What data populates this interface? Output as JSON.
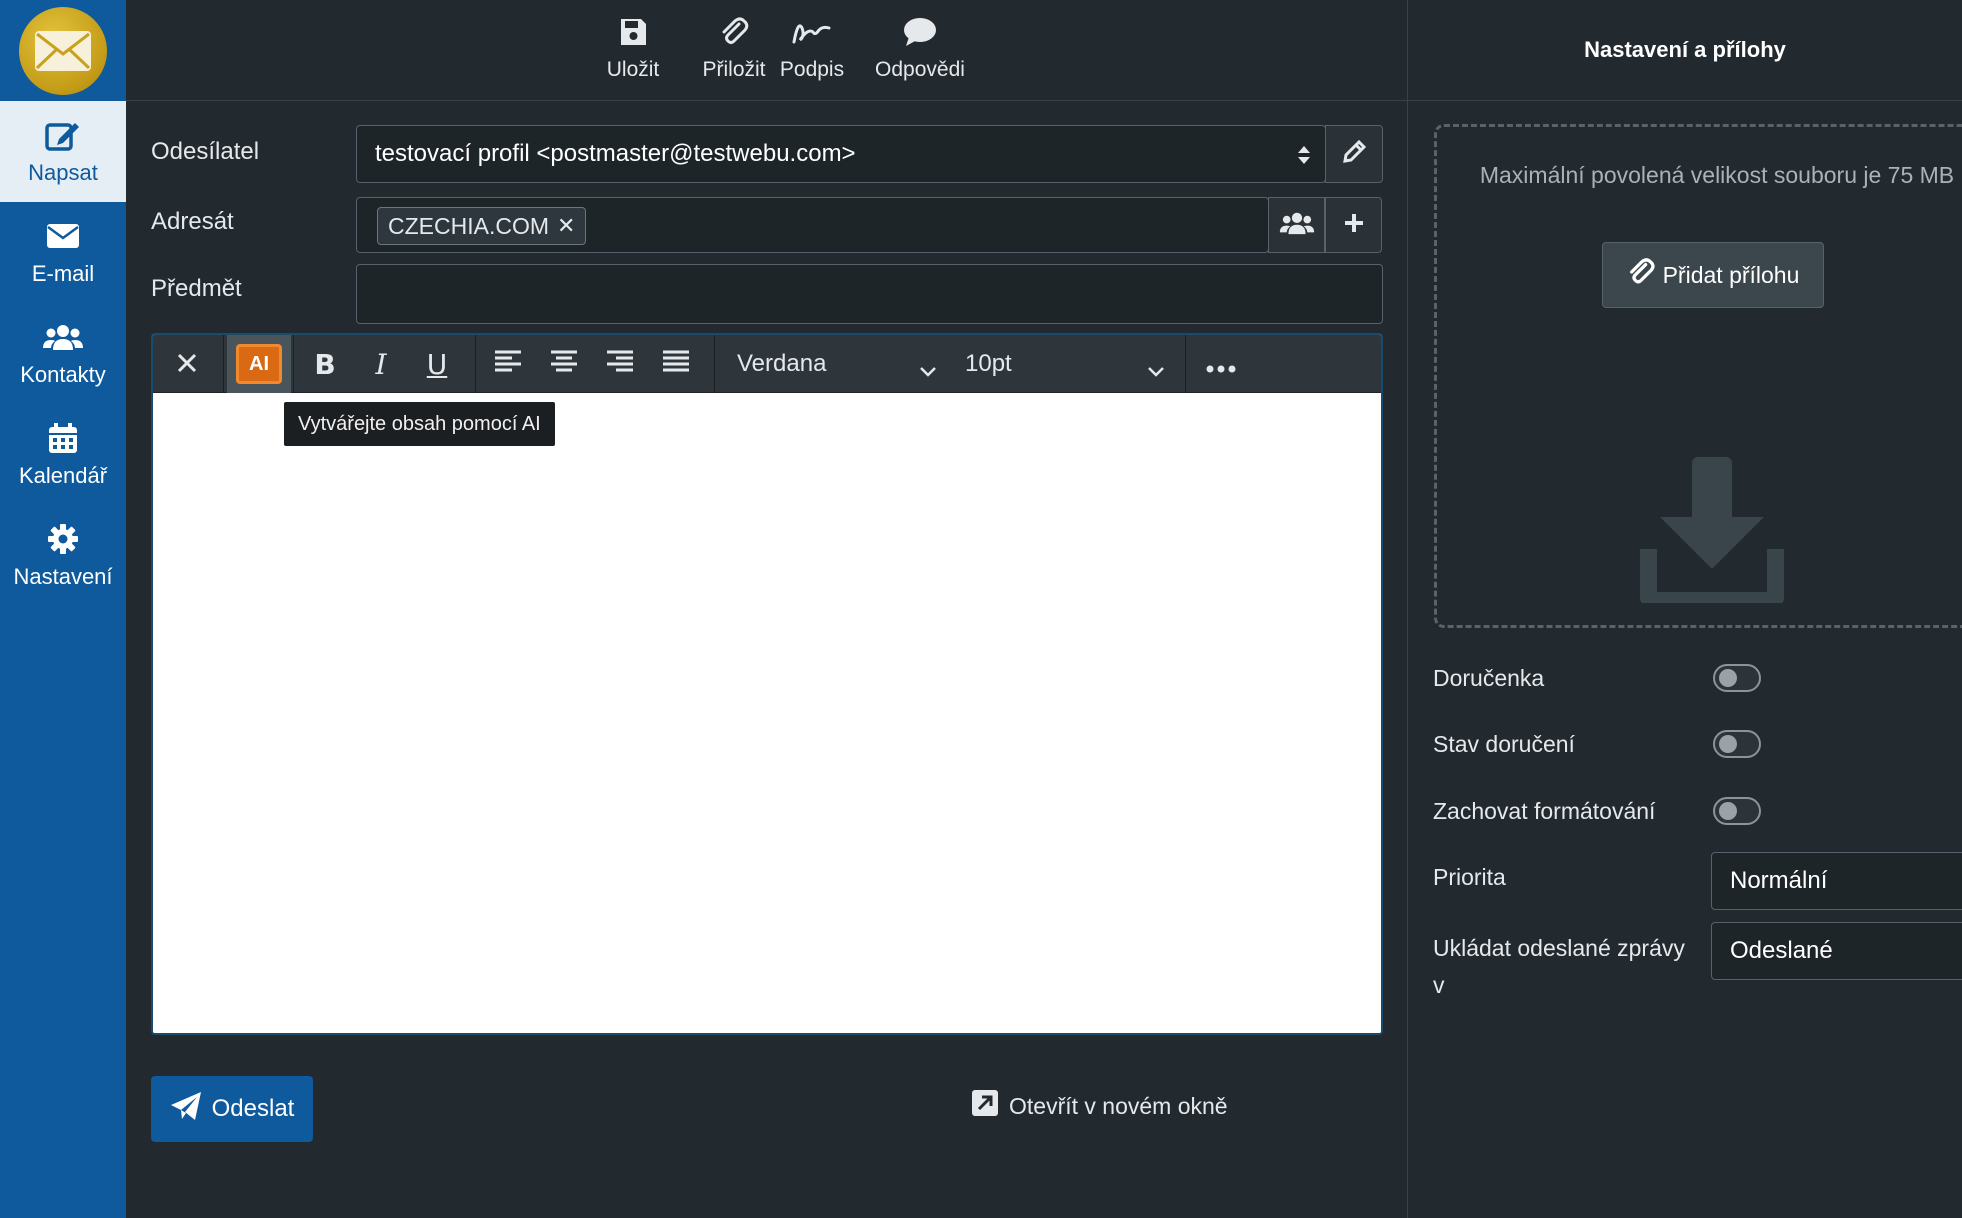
{
  "nav": {
    "items": [
      {
        "label": "Napsat",
        "icon": "compose-icon",
        "active": true
      },
      {
        "label": "E-mail",
        "icon": "envelope-icon"
      },
      {
        "label": "Kontakty",
        "icon": "contacts-icon"
      },
      {
        "label": "Kalendář",
        "icon": "calendar-icon"
      },
      {
        "label": "Nastavení",
        "icon": "gear-icon"
      }
    ]
  },
  "toolbar": {
    "save": "Uložit",
    "attach": "Přiložit",
    "signature": "Podpis",
    "responses": "Odpovědi"
  },
  "compose": {
    "sender_label": "Odesílatel",
    "sender_value": "testovací profil <postmaster@testwebu.com>",
    "to_label": "Adresát",
    "recipients": [
      "CZECHIA.COM"
    ],
    "subject_label": "Předmět",
    "subject_value": ""
  },
  "editor": {
    "ai_label": "AI",
    "font_family": "Verdana",
    "font_size": "10pt",
    "tooltip": "Vytvářejte obsah pomocí AI",
    "body": ""
  },
  "actions": {
    "send": "Odeslat",
    "open_new_window": "Otevřít v novém okně"
  },
  "panel": {
    "title": "Nastavení a přílohy",
    "max_size_text": "Maximální povolená velikost souboru je 75 MB",
    "add_attachment": "Přidat přílohu",
    "options": [
      {
        "label": "Doručenka",
        "enabled": false
      },
      {
        "label": "Stav doručení",
        "enabled": false
      },
      {
        "label": "Zachovat formátování",
        "enabled": false
      }
    ],
    "priority_label": "Priorita",
    "priority_value": "Normální",
    "save_sent_label_line1": "Ukládat odeslané zprávy",
    "save_sent_label_line2": "v",
    "save_sent_value": "Odeslané"
  },
  "colors": {
    "accent": "#0e5a9d",
    "ai_orange": "#d96a13",
    "background": "#22292f"
  }
}
